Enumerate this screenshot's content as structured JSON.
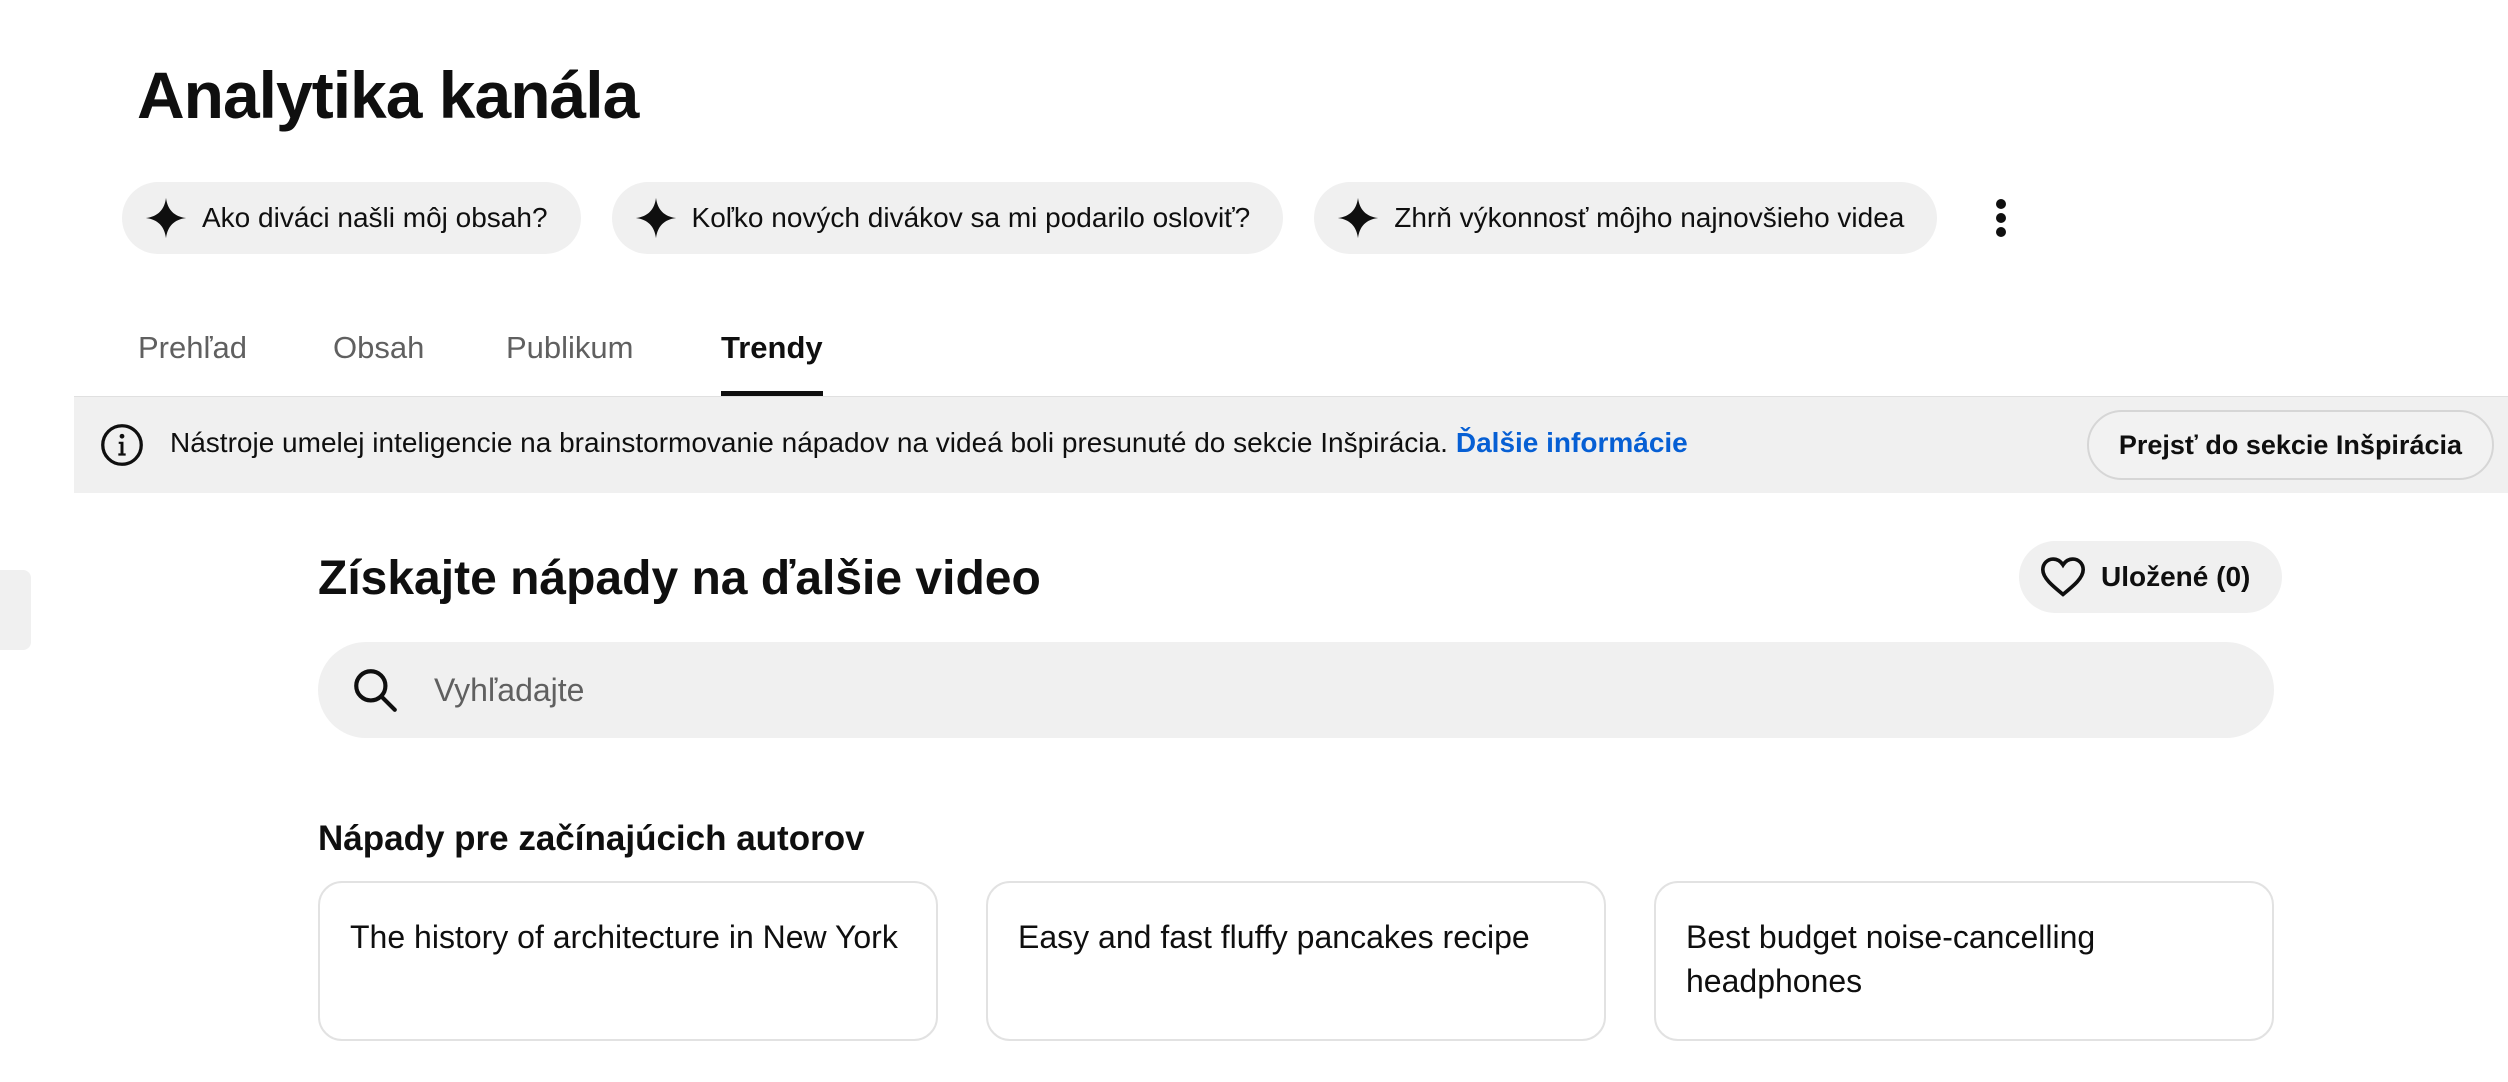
{
  "page_title": "Analytika kanála",
  "ai_chips": [
    {
      "label": "Ako diváci našli môj obsah?",
      "icon": "sparkle-icon"
    },
    {
      "label": "Koľko nových divákov sa mi podarilo osloviť?",
      "icon": "sparkle-icon"
    },
    {
      "label": "Zhrň výkonnosť môjho najnovšieho videa",
      "icon": "sparkle-icon"
    }
  ],
  "more_icon": "more-vertical-icon",
  "tabs": [
    {
      "label": "Prehľad",
      "active": false
    },
    {
      "label": "Obsah",
      "active": false
    },
    {
      "label": "Publikum",
      "active": false
    },
    {
      "label": "Trendy",
      "active": true
    }
  ],
  "info_banner": {
    "icon": "info-icon",
    "text": "Nástroje umelej inteligencie na brainstormovanie nápadov na videá boli presunuté do sekcie Inšpirácia.",
    "link": "Ďalšie informácie",
    "button": "Prejsť do sekcie Inšpirácia"
  },
  "ideas_section": {
    "title": "Získajte nápady na ďalšie video",
    "saved_button": "Uložené (0)",
    "saved_icon": "heart-icon",
    "search": {
      "placeholder": "Vyhľadajte",
      "value": "",
      "icon": "search-icon"
    },
    "beginner_heading": "Nápady pre začínajúcich autorov",
    "cards": [
      "The history of architecture in New York",
      "Easy and fast fluffy pancakes recipe",
      "Best budget noise-cancelling headphones"
    ]
  },
  "colors": {
    "link": "#065fd4",
    "chip_bg": "#f0f0f0",
    "text": "#0f0f0f",
    "muted_text": "#606060"
  }
}
